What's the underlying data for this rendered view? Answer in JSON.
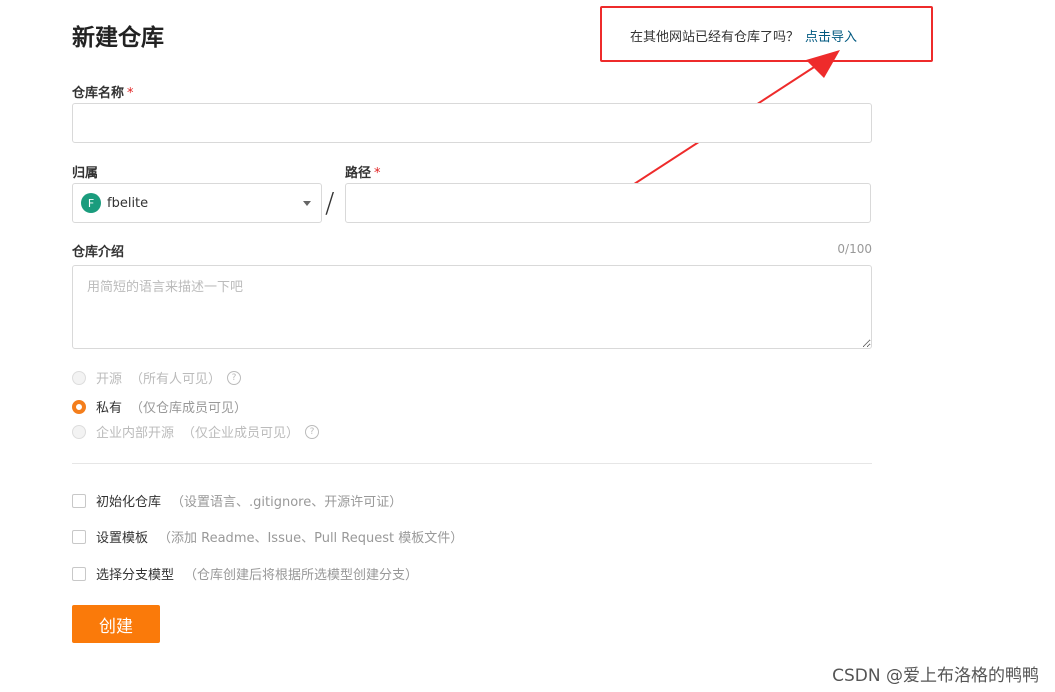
{
  "page": {
    "title": "新建仓库"
  },
  "import_callout": {
    "text": "在其他网站已经有仓库了吗？",
    "link": "点击导入",
    "border_color": "#ee2b2b"
  },
  "form": {
    "name_label": "仓库名称",
    "required_mark": "*",
    "owner_label": "归属",
    "owner_avatar": "F",
    "owner_value": "fbelite",
    "path_separator": "/",
    "path_label": "路径",
    "desc_label": "仓库介绍",
    "desc_counter": "0/100",
    "desc_placeholder": "用简短的语言来描述一下吧",
    "visibility": [
      {
        "label": "开源",
        "hint": "（所有人可见）",
        "state": "disabled",
        "help": "?"
      },
      {
        "label": "私有",
        "hint": "（仅仓库成员可见）",
        "state": "checked"
      },
      {
        "label": "企业内部开源",
        "hint": "（仅企业成员可见）",
        "state": "disabled",
        "help": "?"
      }
    ],
    "options": [
      {
        "label": "初始化仓库",
        "hint": "（设置语言、.gitignore、开源许可证）"
      },
      {
        "label": "设置模板",
        "hint": "（添加 Readme、Issue、Pull Request 模板文件）"
      },
      {
        "label": "选择分支模型",
        "hint": "（仓库创建后将根据所选模型创建分支）"
      }
    ],
    "submit_label": "创建"
  },
  "colors": {
    "accent": "#fa7a0a",
    "link": "#005980",
    "avatar": "#1a9c7d",
    "required": "#e02020"
  },
  "watermark": "CSDN @爱上布洛格的鸭鸭"
}
